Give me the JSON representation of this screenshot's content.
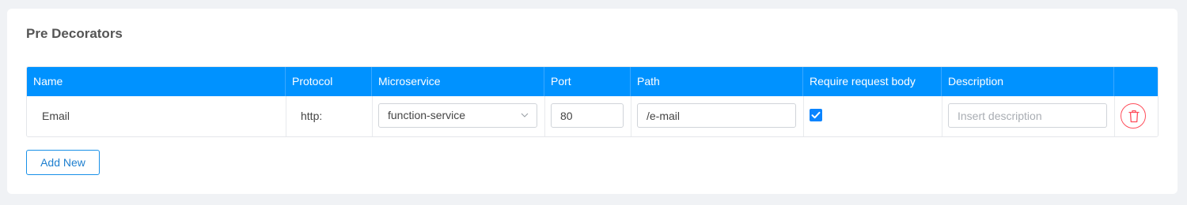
{
  "section": {
    "title": "Pre Decorators"
  },
  "table": {
    "headers": [
      "Name",
      "Protocol",
      "Microservice",
      "Port",
      "Path",
      "Require request body",
      "Description",
      ""
    ],
    "rows": [
      {
        "name": "Email",
        "protocol": "http:",
        "microservice": "function-service",
        "port": "80",
        "path": "/e-mail",
        "require_request_body": true,
        "description_value": "",
        "description_placeholder": "Insert description",
        "delete_icon": "trash-icon"
      }
    ]
  },
  "actions": {
    "add_new_label": "Add New"
  },
  "colors": {
    "header_bg": "#0092ff",
    "accent": "#0a84ff",
    "danger": "#ff4d5a",
    "page_bg": "#f0f2f5"
  }
}
